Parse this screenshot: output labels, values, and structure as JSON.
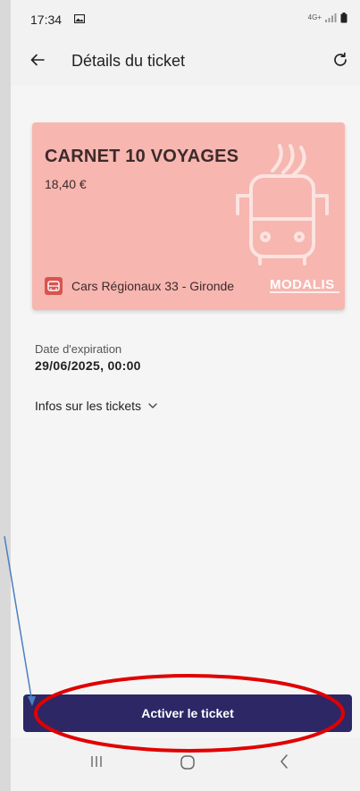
{
  "status_bar": {
    "time": "17:34",
    "network": "4G+"
  },
  "header": {
    "title": "Détails du ticket"
  },
  "ticket": {
    "name": "CARNET 10 VOYAGES",
    "price": "18,40 €",
    "operator": "Cars Régionaux 33 - Gironde",
    "logo_text": "MODALIS",
    "card_color": "#f7b6b0"
  },
  "details": {
    "expiry_label": "Date d'expiration",
    "expiry_value": "29/06/2025, 00:00",
    "info_label": "Infos sur les tickets"
  },
  "actions": {
    "activate_label": "Activer le ticket",
    "activate_color": "#2d2766"
  },
  "annotation": {
    "ellipse_color": "#e00000",
    "arrow_color": "#4a7fc1"
  },
  "icons": {
    "back": "arrow-left-icon",
    "refresh": "refresh-icon",
    "info_chevron": "chevron-down-icon",
    "nav_recent": "recent-apps-icon",
    "nav_home": "home-icon",
    "nav_back": "back-icon"
  }
}
